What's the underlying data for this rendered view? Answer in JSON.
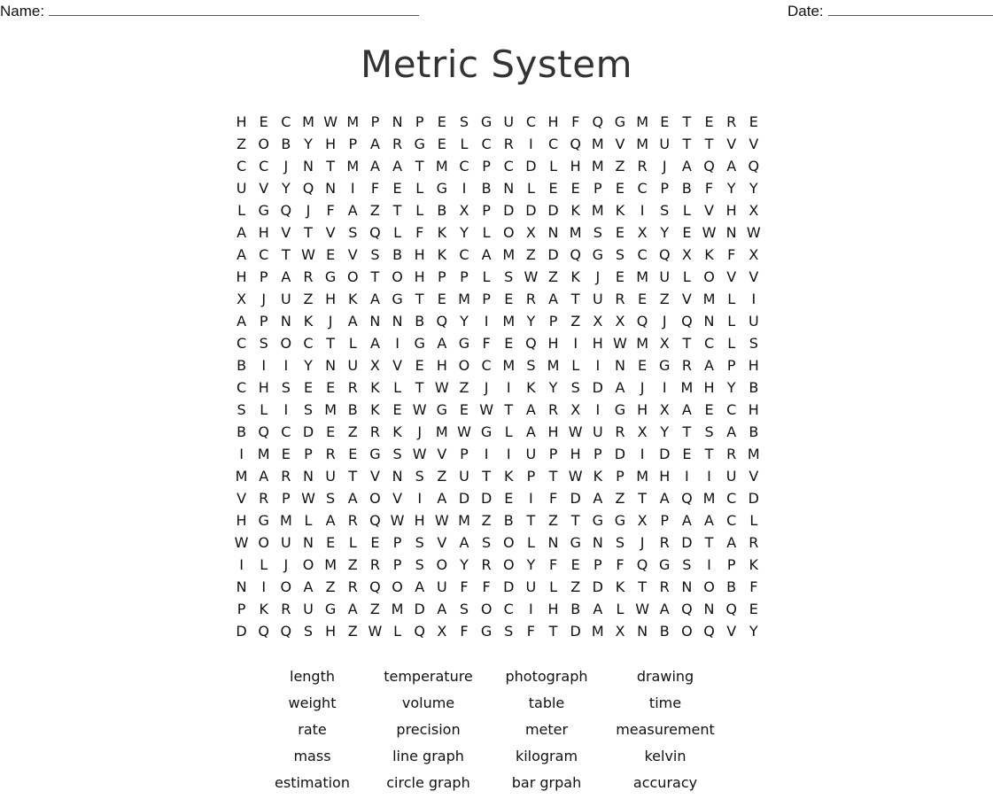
{
  "header": {
    "name_label": "Name:",
    "date_label": "Date:"
  },
  "title": "Metric System",
  "grid": [
    "HECMWMPNPESGUCHFQGMETERE",
    "ZOBYHPARGELCRICQMVMUTTVV",
    "CCJNTMAATMCPCDLHMZRJAQAQ",
    "UVYQNIFELGIBNLEEPECPBFYY",
    "LGQJFAZTLBXPDDDKMKISLVHX",
    "AHVTVSQLFKYLOXNMSEXYEWNW",
    "ACTWEVSBHKCAMZDQGSCQXKFX",
    "HPARGOTOHPPLSWZKJEMULOVV",
    "XJUZHKAGTEMPERATUREZVMLI",
    "APNKJANNBQYIMYPZXXQJQNLU",
    "CSOCTLAIGAGFEQHIHWMXTCLS",
    "BIIYNUXVEHOCMSMLINEGRAPH",
    "CHSEERKLTWZJIKYSDAJIMHYB",
    "SLISMBKEWGEWTARXIGHXAECH",
    "BQCDEZRKJMWGLAHWURXYTSAB",
    "IMEPREGSWVPIIUPHPDIDETRM",
    "MARNUTVNSZUTKPTWKPMHIIUV",
    "VRPWSAOVIADDEIFDAZTAQMCD",
    "HGMLARQWHWMZBTZTGGXPAACL",
    "WOUNELEPSVASOLNGNSJRDTAR",
    "ILJOMZRPSOYROYFEPFQGSIPK",
    "NIOAZRQOAUFFDULZDKTRNOBF",
    "PKRUGAZMDASOCIHBALWAQNQE",
    "DQQSHZWLQXFGSFTDMXNBOQVY"
  ],
  "word_bank": [
    "length",
    "temperature",
    "photograph",
    "drawing",
    "weight",
    "volume",
    "table",
    "time",
    "rate",
    "precision",
    "meter",
    "measurement",
    "mass",
    "line graph",
    "kilogram",
    "kelvin",
    "estimation",
    "circle graph",
    "bar grpah",
    "accuracy"
  ]
}
